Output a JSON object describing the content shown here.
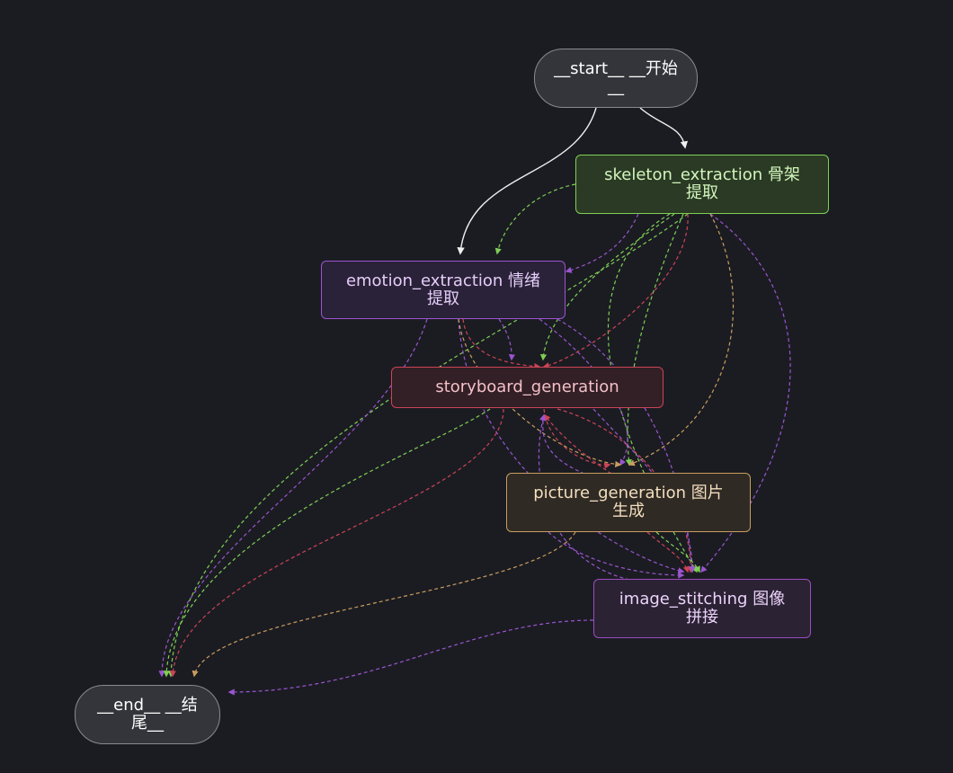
{
  "colors": {
    "background": "#1b1c22",
    "start_edge": "#f0f0f0",
    "green_edge": "#7fcf55",
    "purple_edge": "#9a55d0",
    "red_edge": "#cc4455",
    "orange_edge": "#c99d5f"
  },
  "nodes": {
    "start": {
      "label": "__start__  __开始\n__"
    },
    "skeleton": {
      "label": "skeleton_extraction  骨架\n提取"
    },
    "emotion": {
      "label": "emotion_extraction  情绪\n提取"
    },
    "storyboard": {
      "label": "storyboard_generation"
    },
    "picture": {
      "label": "picture_generation  图片\n生成"
    },
    "stitching": {
      "label": "image_stitching  图像\n拼接"
    },
    "end": {
      "label": "__end__  __结\n尾__"
    }
  }
}
